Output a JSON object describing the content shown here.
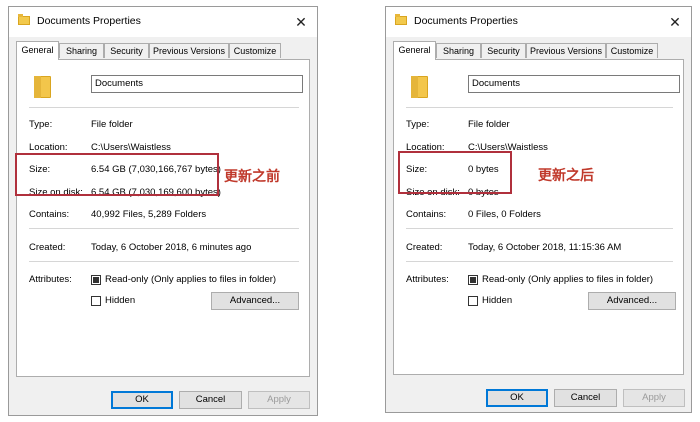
{
  "left": {
    "title": "Documents Properties",
    "tabs": [
      "General",
      "Sharing",
      "Security",
      "Previous Versions",
      "Customize"
    ],
    "name_value": "Documents",
    "type_label": "Type:",
    "type_value": "File folder",
    "location_label": "Location:",
    "location_value": "C:\\Users\\Waistless",
    "size_label": "Size:",
    "size_value": "6.54 GB (7,030,166,767 bytes)",
    "size_on_disk_label": "Size on disk:",
    "size_on_disk_value": "6.54 GB (7,030,169,600 bytes)",
    "contains_label": "Contains:",
    "contains_value": "40,992 Files, 5,289 Folders",
    "created_label": "Created:",
    "created_value": "Today, 6 October 2018, 6 minutes ago",
    "attributes_label": "Attributes:",
    "readonly_label": "Read-only (Only applies to files in folder)",
    "hidden_label": "Hidden",
    "advanced_label": "Advanced...",
    "ok_label": "OK",
    "cancel_label": "Cancel",
    "apply_label": "Apply",
    "annotation": "更新之前"
  },
  "right": {
    "title": "Documents Properties",
    "tabs": [
      "General",
      "Sharing",
      "Security",
      "Previous Versions",
      "Customize"
    ],
    "name_value": "Documents",
    "type_label": "Type:",
    "type_value": "File folder",
    "location_label": "Location:",
    "location_value": "C:\\Users\\Waistless",
    "size_label": "Size:",
    "size_value": "0 bytes",
    "size_on_disk_label": "Size on disk:",
    "size_on_disk_value": "0 bytes",
    "contains_label": "Contains:",
    "contains_value": "0 Files, 0 Folders",
    "created_label": "Created:",
    "created_value": "Today, 6 October 2018, 11:15:36 AM",
    "attributes_label": "Attributes:",
    "readonly_label": "Read-only (Only applies to files in folder)",
    "hidden_label": "Hidden",
    "advanced_label": "Advanced...",
    "ok_label": "OK",
    "cancel_label": "Cancel",
    "apply_label": "Apply",
    "annotation": "更新之后"
  },
  "colors": {
    "highlight": "#b0303c",
    "annotation": "#c0392b",
    "default_button_border": "#0078d7"
  }
}
